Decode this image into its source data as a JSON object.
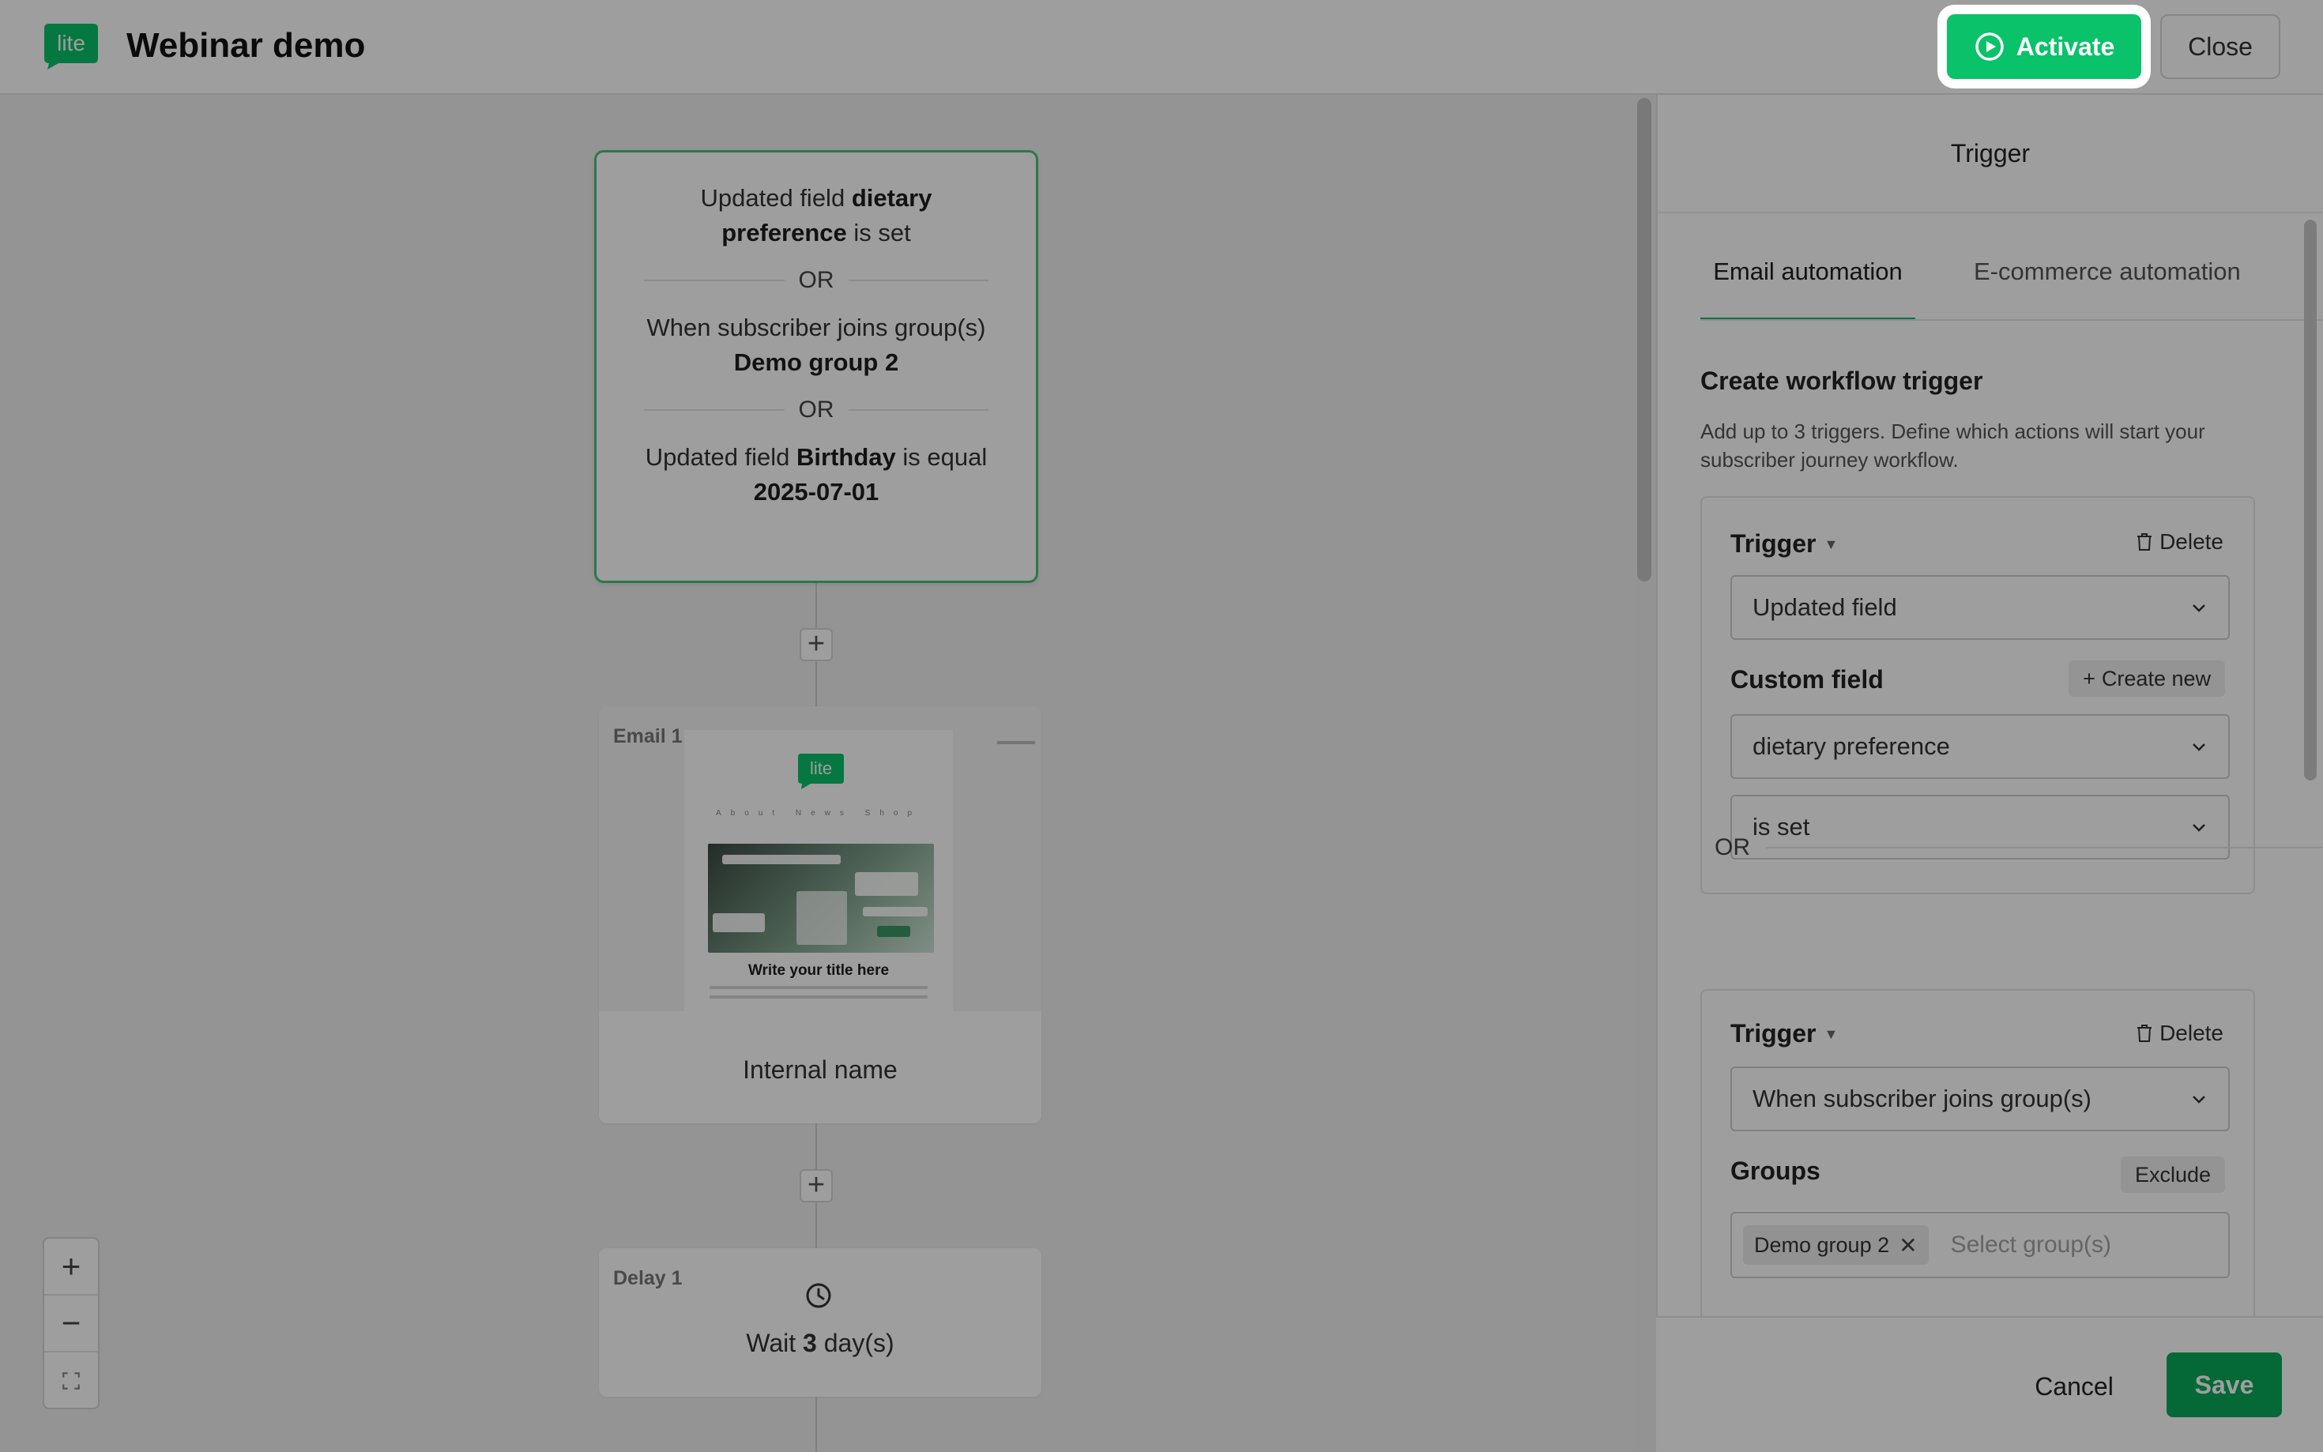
{
  "header": {
    "title": "Webinar demo",
    "logo_text": "lite",
    "activate_label": "Activate",
    "close_label": "Close"
  },
  "canvas": {
    "trigger_node": {
      "lines": [
        {
          "pre": "Updated field ",
          "bold": "dietary preference",
          "post": " is set"
        },
        {
          "pre": "When subscriber joins group(s) ",
          "bold": "Demo group 2",
          "post": ""
        },
        {
          "pre": "Updated field ",
          "bold": "Birthday",
          "post": " is equal ",
          "bold2": "2025-07-01"
        }
      ],
      "separator": "OR"
    },
    "email_node": {
      "tag": "Email 1",
      "name": "Internal name",
      "preview": {
        "logo_text": "lite",
        "nav": "About  News  Shop",
        "title": "Write your title here"
      }
    },
    "delay_node": {
      "tag": "Delay 1",
      "text_pre": "Wait ",
      "text_bold": "3",
      "text_post": " day(s)"
    },
    "zoom": {
      "in": "+",
      "out": "−",
      "fit_icon": "fit-screen-icon"
    }
  },
  "panel": {
    "title": "Trigger",
    "tabs": [
      {
        "label": "Email automation",
        "active": true
      },
      {
        "label": "E-commerce automation",
        "active": false
      }
    ],
    "section_title": "Create workflow trigger",
    "section_desc": "Add up to 3 triggers. Define which actions will start your subscriber journey workflow.",
    "triggers": [
      {
        "label": "Trigger",
        "delete": "Delete",
        "type": "Updated field",
        "field_label": "Custom field",
        "create_new": "Create new",
        "field_value": "dietary preference",
        "condition": "is set"
      },
      {
        "label": "Trigger",
        "delete": "Delete",
        "type": "When subscriber joins group(s)",
        "groups_label": "Groups",
        "exclude": "Exclude",
        "selected_group": "Demo group 2",
        "group_placeholder": "Select group(s)"
      }
    ],
    "or_label": "OR",
    "cancel_label": "Cancel",
    "save_label": "Save"
  },
  "colors": {
    "brand_green": "#09c269",
    "save_green": "#09a85a",
    "card_border_green": "#48c27a",
    "overlay": "rgba(0,0,0,0.38)"
  }
}
